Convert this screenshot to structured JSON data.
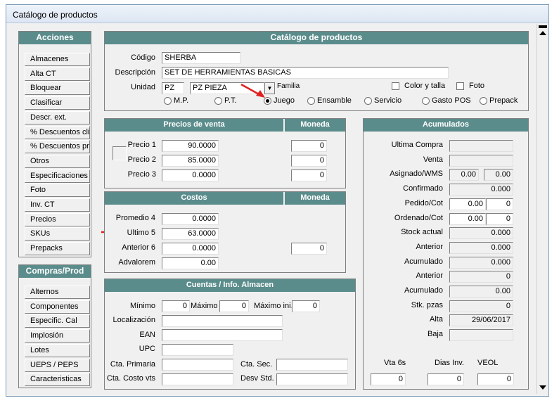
{
  "window": {
    "title": "Catálogo de productos"
  },
  "sidebar": {
    "acciones_title": "Acciones",
    "acciones": [
      "Almacenes",
      "Alta CT",
      "Bloquear",
      "Clasificar",
      "Descr. ext.",
      "% Descuentos clis",
      "% Descuentos prv",
      "Otros",
      "Especificaciones",
      "Foto",
      "Inv. CT",
      "Precios",
      "SKUs",
      "Prepacks"
    ],
    "compras_title": "Compras/Prod",
    "compras": [
      "Alternos",
      "Componentes",
      "Especific. Cal",
      "Implosión",
      "Lotes",
      "UEPS / PEPS",
      "Caracteristicas"
    ]
  },
  "catalog": {
    "header": "Catálogo de productos",
    "codigo_label": "Código",
    "codigo": "SHERBA",
    "descripcion_label": "Descripción",
    "descripcion": "SET DE HERRAMIENTAS BASICAS",
    "unidad_label": "Unidad",
    "unidad_code": "PZ",
    "unidad_name": "PZ  PIEZA",
    "familia_label": "Familia",
    "color_talla_label": "Color y talla",
    "foto_label": "Foto",
    "types": [
      "M.P.",
      "P.T.",
      "Juego",
      "Ensamble",
      "Servicio",
      "Gasto POS",
      "Prepack"
    ],
    "selected_type": "Juego"
  },
  "precios": {
    "header": "Precios de venta",
    "moneda_header": "Moneda",
    "rows": [
      {
        "label": "Precio 1",
        "value": "90.0000",
        "moneda": "0"
      },
      {
        "label": "Precio 2",
        "value": "85.0000",
        "moneda": "0"
      },
      {
        "label": "Precio 3",
        "value": "0.0000",
        "moneda": "0"
      }
    ]
  },
  "costos": {
    "header": "Costos",
    "moneda_header": "Moneda",
    "rows": [
      {
        "label": "Promedio 4",
        "value": "0.0000"
      },
      {
        "label": "Ultimo 5",
        "value": "63.0000"
      },
      {
        "label": "Anterior 6",
        "value": "0.0000",
        "moneda": "0"
      },
      {
        "label": "Advalorem",
        "value": "0.00"
      }
    ]
  },
  "cuentas": {
    "header": "Cuentas / Info. Almacen",
    "minimo_label": "Mínimo",
    "minimo": "0",
    "maximo_label": "Máximo",
    "maximo": "0",
    "maximo_ini_label": "Máximo ini.",
    "maximo_ini": "0",
    "localizacion_label": "Localización",
    "ean_label": "EAN",
    "upc_label": "UPC",
    "cta_primaria_label": "Cta. Primaria",
    "cta_sec_label": "Cta. Sec.",
    "cta_costo_label": "Cta. Costo vts",
    "desv_std_label": "Desv Std."
  },
  "acumulados": {
    "header": "Acumulados",
    "ultima_compra_label": "Ultima  Compra",
    "venta_label": "Venta",
    "asignado_label": "Asignado/WMS",
    "asignado_a": "0.00",
    "asignado_b": "0.00",
    "confirmado_label": "Confirmado",
    "confirmado": "0.000",
    "pedido_label": "Pedido/Cot",
    "pedido_a": "0.00",
    "pedido_b": "0",
    "ordenado_label": "Ordenado/Cot",
    "ordenado_a": "0.00",
    "ordenado_b": "0",
    "stock_label": "Stock actual",
    "stock": "0.000",
    "anterior1_label": "Anterior",
    "anterior1": "0.000",
    "acumulado1_label": "Acumulado",
    "acumulado1": "0.000",
    "anterior2_label": "Anterior",
    "anterior2": "0",
    "acumulado2_label": "Acumulado",
    "acumulado2": "0.00",
    "stk_label": "Stk. pzas",
    "stk": "0",
    "alta_label": "Alta",
    "alta": "29/06/2017",
    "baja_label": "Baja",
    "vta6s_label": "Vta 6s",
    "vta6s": "0",
    "dias_label": "Dias Inv.",
    "dias": "0",
    "veol_label": "VEOL",
    "veol": "0"
  },
  "colors": {
    "header": "#5b8c8c",
    "arrow": "#e02020"
  }
}
